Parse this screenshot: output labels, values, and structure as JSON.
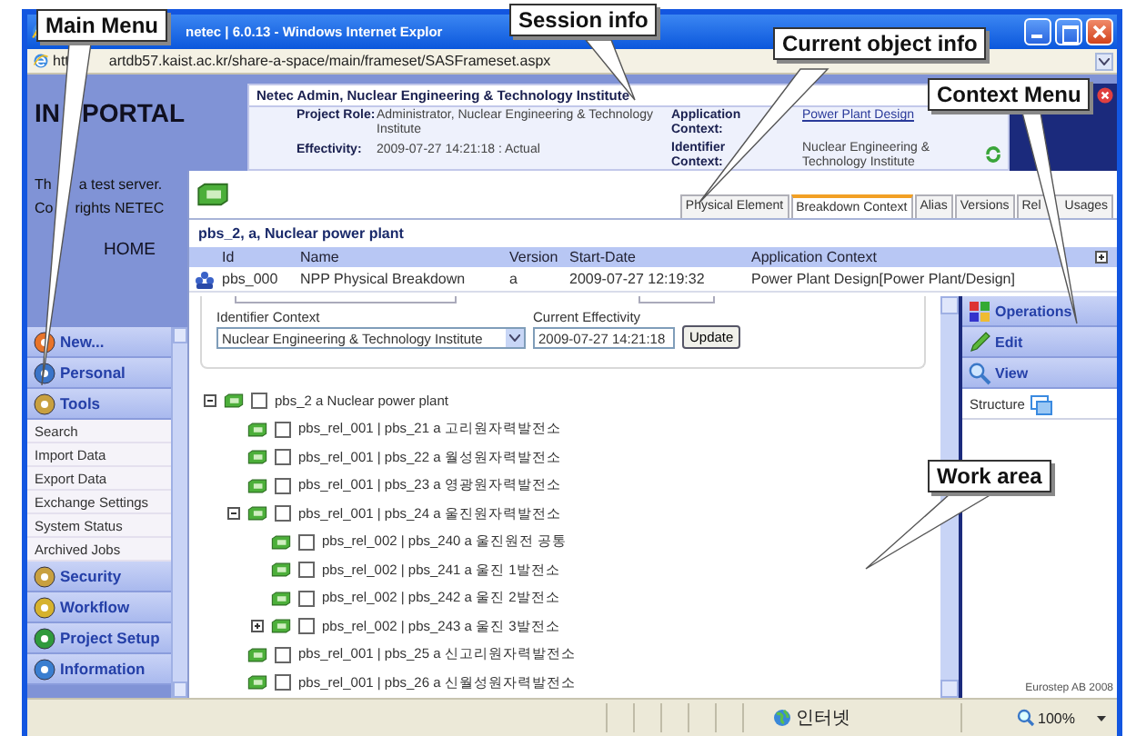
{
  "window": {
    "title": "netec | 6.0.13 - Windows Internet Explor",
    "address_start": "htt",
    "address": "artdb57.kaist.ac.kr/share-a-space/main/frameset/SASFrameset.aspx"
  },
  "sidebar": {
    "logo_start": "IN",
    "logo_end": "PORTAL",
    "notice": [
      {
        "start": "Th",
        "end": "a test server."
      },
      {
        "start": "Co",
        "end": "rights NETEC"
      }
    ],
    "home": "HOME",
    "menu": [
      {
        "kind": "section",
        "label": "New..."
      },
      {
        "kind": "section",
        "label": "Personal"
      },
      {
        "kind": "section",
        "label": "Tools"
      },
      {
        "kind": "link",
        "label": "Search"
      },
      {
        "kind": "link",
        "label": "Import Data"
      },
      {
        "kind": "link",
        "label": "Export Data"
      },
      {
        "kind": "link",
        "label": "Exchange Settings"
      },
      {
        "kind": "link",
        "label": "System Status"
      },
      {
        "kind": "link",
        "label": "Archived Jobs"
      },
      {
        "kind": "section",
        "label": "Security"
      },
      {
        "kind": "section",
        "label": "Workflow"
      },
      {
        "kind": "section",
        "label": "Project Setup"
      },
      {
        "kind": "section",
        "label": "Information"
      }
    ]
  },
  "session": {
    "title": "Netec Admin, Nuclear Engineering & Technology Institute",
    "fields": [
      {
        "label": "Project Role:",
        "value": "Administrator, Nuclear Engineering & Technology Institute"
      },
      {
        "label": "Effectivity:",
        "value": "2009-07-27 14:21:18 : Actual"
      }
    ],
    "context_fields": [
      {
        "label": "Application Context:",
        "value": "Power Plant Design",
        "kind": "link"
      },
      {
        "label": "Identifier Context:",
        "value": "Nuclear Engineering & Technology Institute",
        "kind": "text"
      }
    ]
  },
  "object": {
    "tabs": [
      {
        "label": "Physical Element",
        "selected": false
      },
      {
        "label": "Breakdown Context",
        "selected": true
      },
      {
        "label": "Alias",
        "selected": false
      },
      {
        "label": "Versions",
        "selected": false
      },
      {
        "label": "Rel",
        "label_tail": "Usages",
        "selected": false
      }
    ],
    "title": "pbs_2, a, Nuclear power plant",
    "table": {
      "columns": [
        "Id",
        "Name",
        "Version",
        "Start-Date",
        "Application Context"
      ],
      "rows": [
        [
          "pbs_000",
          "NPP Physical Breakdown",
          "a",
          "2009-07-27 12:19:32",
          "Power Plant Design[Power Plant/Design]"
        ]
      ]
    }
  },
  "work_area": {
    "identifier_context": {
      "label": "Identifier Context",
      "value": "Nuclear Engineering & Technology Institute"
    },
    "current_effectivity": {
      "label": "Current Effectivity",
      "value": "2009-07-27 14:21:18"
    },
    "update_button": "Update",
    "tree": [
      {
        "label": "pbs_2 a Nuclear power plant",
        "checked": false,
        "expanded": true,
        "children": [
          {
            "label": "pbs_rel_001 | pbs_21 a 고리원자력발전소",
            "checked": false
          },
          {
            "label": "pbs_rel_001 | pbs_22 a 월성원자력발전소",
            "checked": false
          },
          {
            "label": "pbs_rel_001 | pbs_23 a 영광원자력발전소",
            "checked": false
          },
          {
            "label": "pbs_rel_001 | pbs_24 a 울진원자력발전소",
            "checked": false,
            "expanded": true,
            "children": [
              {
                "label": "pbs_rel_002 | pbs_240 a 울진원전 공통",
                "checked": false
              },
              {
                "label": "pbs_rel_002 | pbs_241 a 울진 1발전소",
                "checked": false
              },
              {
                "label": "pbs_rel_002 | pbs_242 a 울진 2발전소",
                "checked": false
              },
              {
                "label": "pbs_rel_002 | pbs_243 a 울진 3발전소",
                "checked": false,
                "expanded": false
              }
            ]
          },
          {
            "label": "pbs_rel_001 | pbs_25 a 신고리원자력발전소",
            "checked": false
          },
          {
            "label": "pbs_rel_001 | pbs_26 a 신월성원자력발전소",
            "checked": false
          }
        ]
      }
    ]
  },
  "context_menu": [
    {
      "kind": "section",
      "label": "Operations"
    },
    {
      "kind": "section",
      "label": "Edit"
    },
    {
      "kind": "section",
      "label": "View"
    },
    {
      "kind": "link",
      "label": "Structure"
    }
  ],
  "footer": "Eurostep AB 2008",
  "status_bar": {
    "zone": "인터넷",
    "zoom": "100%"
  },
  "callouts": [
    {
      "label": "Main Menu"
    },
    {
      "label": "Session info"
    },
    {
      "label": "Current object info"
    },
    {
      "label": "Context Menu"
    },
    {
      "label": "Work area"
    }
  ]
}
